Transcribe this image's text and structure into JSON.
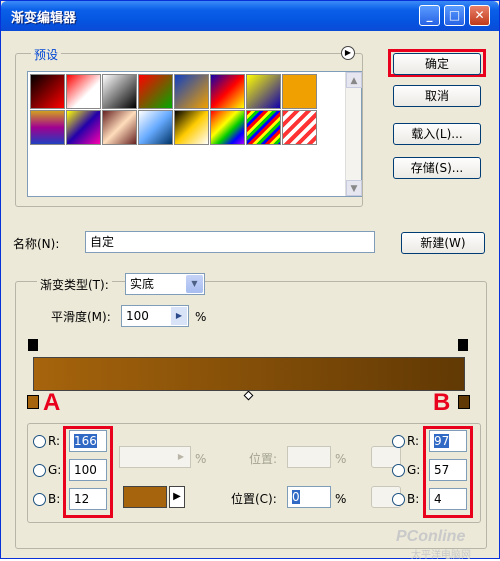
{
  "window": {
    "title": "渐变编辑器"
  },
  "titlebar_buttons": {
    "minimize": "_",
    "maximize": "□",
    "close": "✕"
  },
  "presets": {
    "legend": "预设",
    "menu_icon": "▶"
  },
  "buttons": {
    "ok": "确定",
    "cancel": "取消",
    "load": "载入(L)...",
    "save": "存储(S)...",
    "new": "新建(W)"
  },
  "name": {
    "label": "名称(N):",
    "value": "自定"
  },
  "gradient": {
    "type_label": "渐变类型(T):",
    "type_value": "实底",
    "smooth_label": "平滑度(M):",
    "smooth_value": "100",
    "smooth_unit": "%",
    "start_color": "#a6640c",
    "end_color": "#613904"
  },
  "stops_left": {
    "r_label": "R:",
    "r_value": "166",
    "g_label": "G:",
    "g_value": "100",
    "b_label": "B:",
    "b_value": "12"
  },
  "stops_right": {
    "r_label": "R:",
    "r_value": "97",
    "g_label": "G:",
    "g_value": "57",
    "b_label": "B:",
    "b_value": "4"
  },
  "opacity_row": {
    "unit": "%",
    "position_label": "位置:",
    "position_unit": "%"
  },
  "color_row": {
    "position_label": "位置(C):",
    "position_value": "0",
    "position_unit": "%"
  },
  "annotations": {
    "a": "A",
    "b": "B"
  },
  "watermark": {
    "text": "PConline",
    "sub": "太平洋电脑网"
  },
  "colors": {
    "accent": "#0046d5",
    "highlight": "#e8001c"
  }
}
